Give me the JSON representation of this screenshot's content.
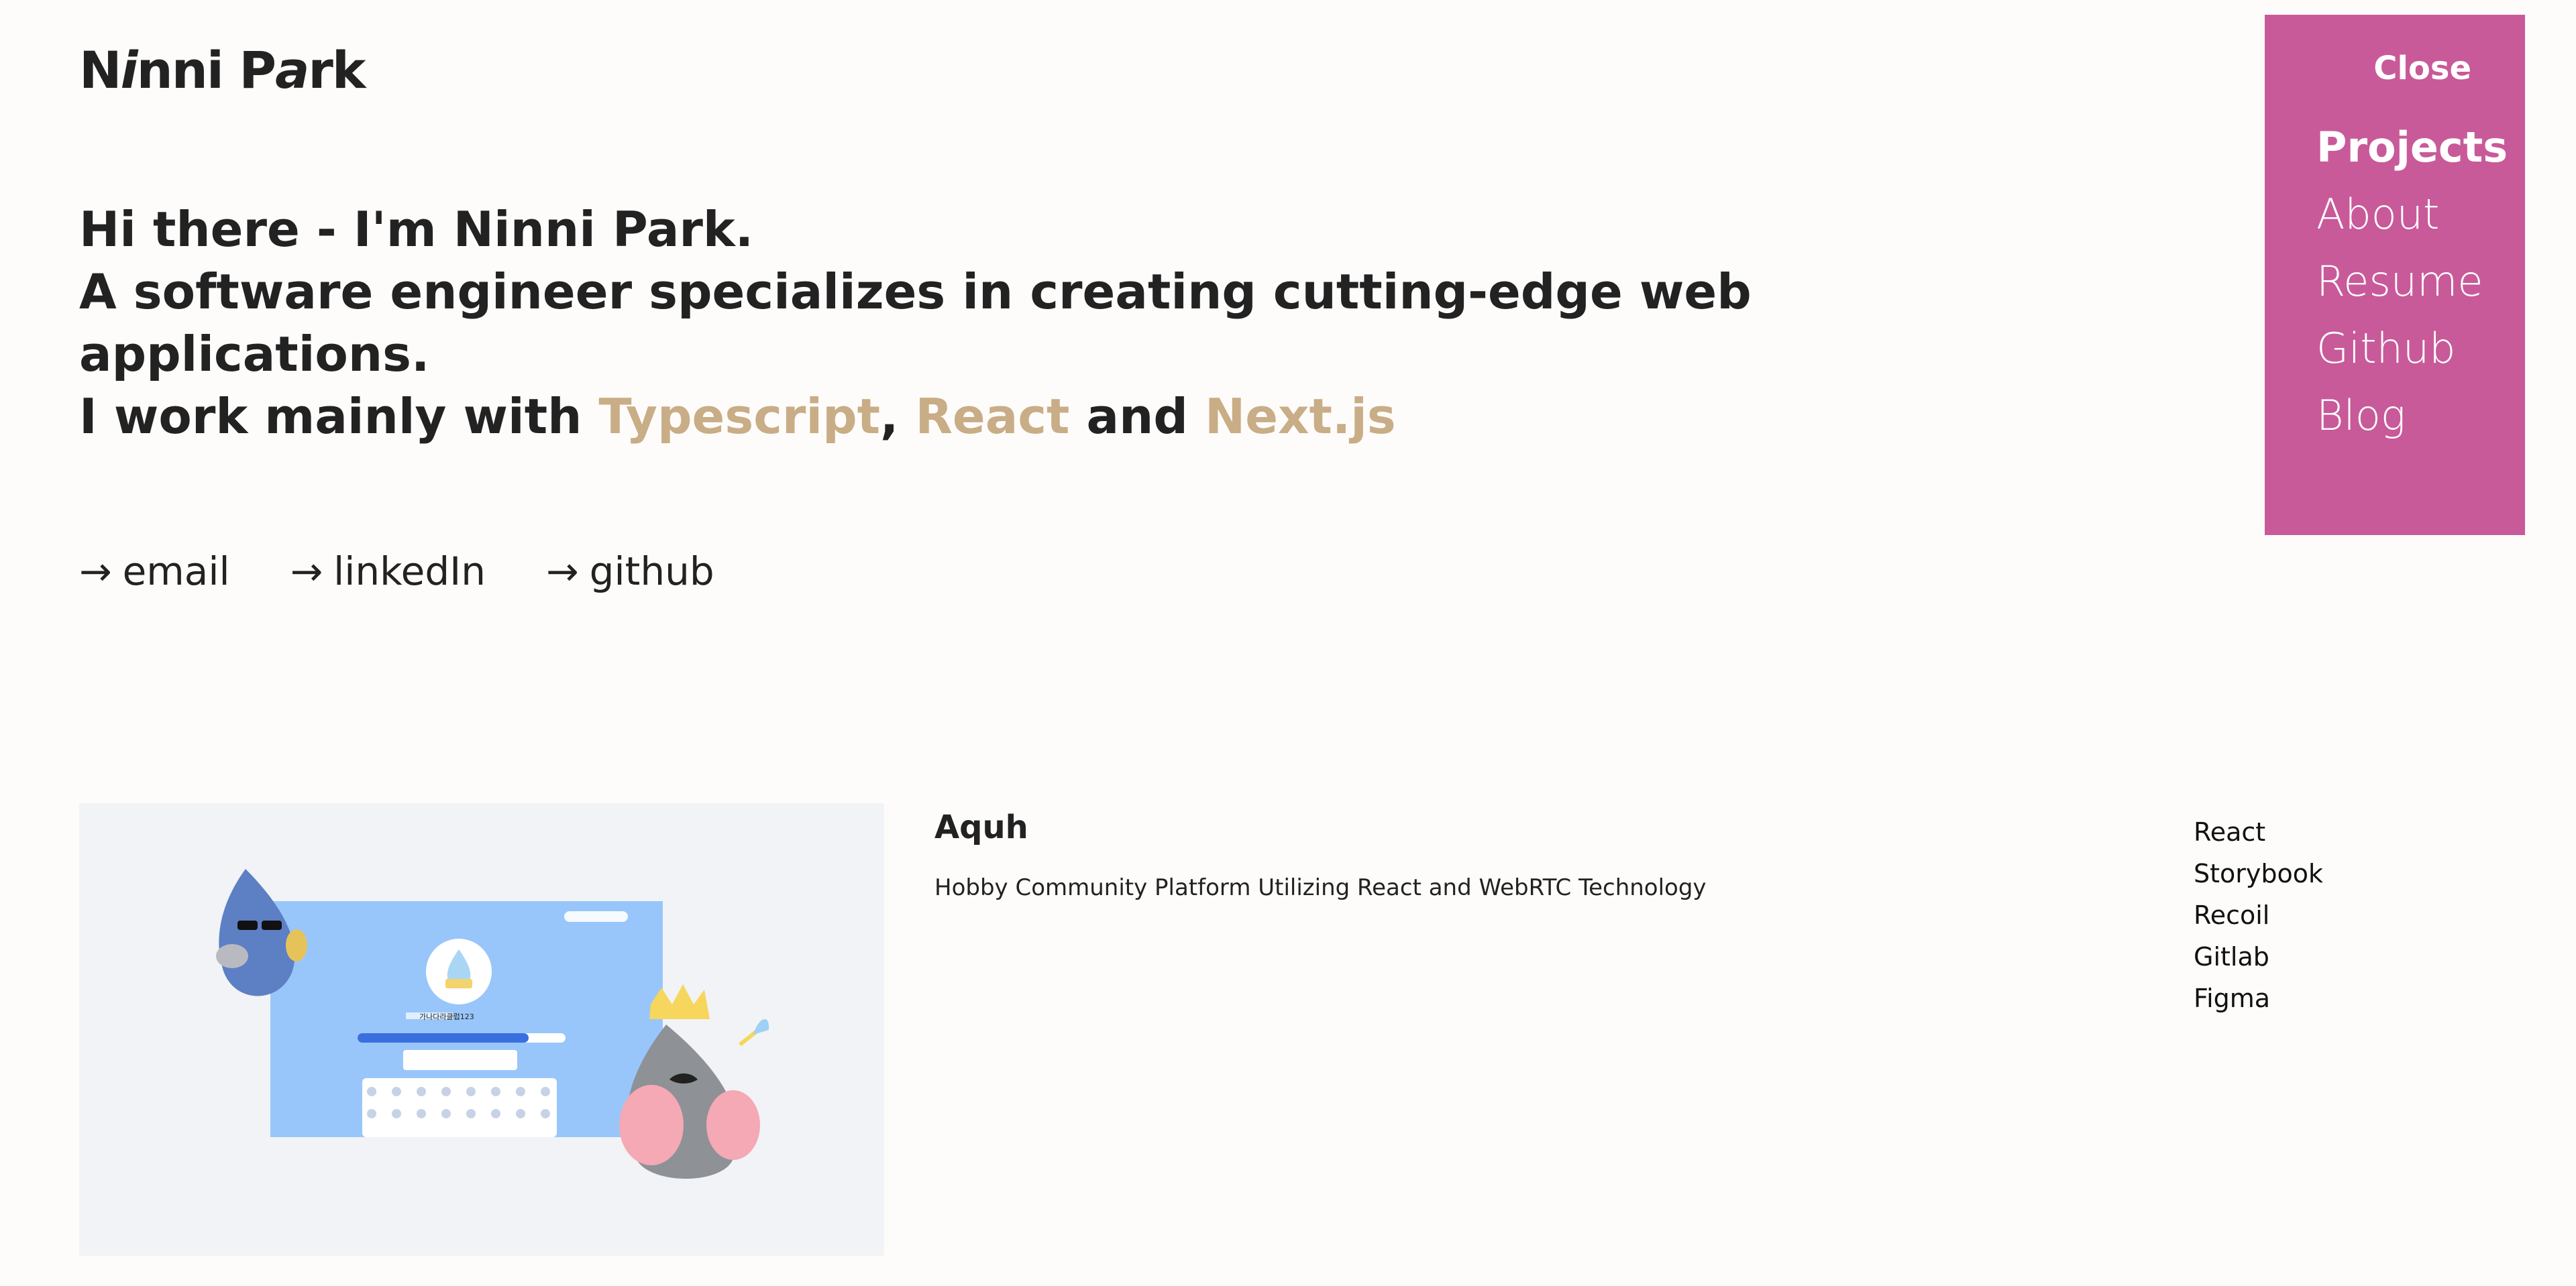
{
  "header": {
    "logo_part1": "N",
    "logo_part2": "i",
    "logo_part3": "nni P",
    "logo_part4": "a",
    "logo_part5": "rk"
  },
  "hero": {
    "line1": "Hi there - I'm Ninni Park.",
    "line2": "A software engineer specializes in creating cutting-edge web",
    "line3": "applications.",
    "line4_prefix": "I work mainly with ",
    "tech1": "Typescript",
    "sep1": ", ",
    "tech2": "React",
    "sep2": " and ",
    "tech3": "Next.js"
  },
  "contacts": [
    {
      "arrow": "→",
      "label": "email"
    },
    {
      "arrow": "→",
      "label": "linkedIn"
    },
    {
      "arrow": "→",
      "label": "github"
    }
  ],
  "menu": {
    "close_label": "Close",
    "items": [
      "Projects",
      "About",
      "Resume",
      "Github",
      "Blog"
    ],
    "active": "Projects",
    "bg_color": "#c85a9a"
  },
  "project": {
    "title": "Aquh",
    "description": "Hobby Community Platform Utilizing React and WebRTC Technology",
    "stack": [
      "React",
      "Storybook",
      "Recoil",
      "Gitlab",
      "Figma"
    ],
    "screen_name": "가나다라클럽123"
  },
  "colors": {
    "accent": "#c8ad86",
    "text": "#222222",
    "background": "#fdfcfa"
  }
}
